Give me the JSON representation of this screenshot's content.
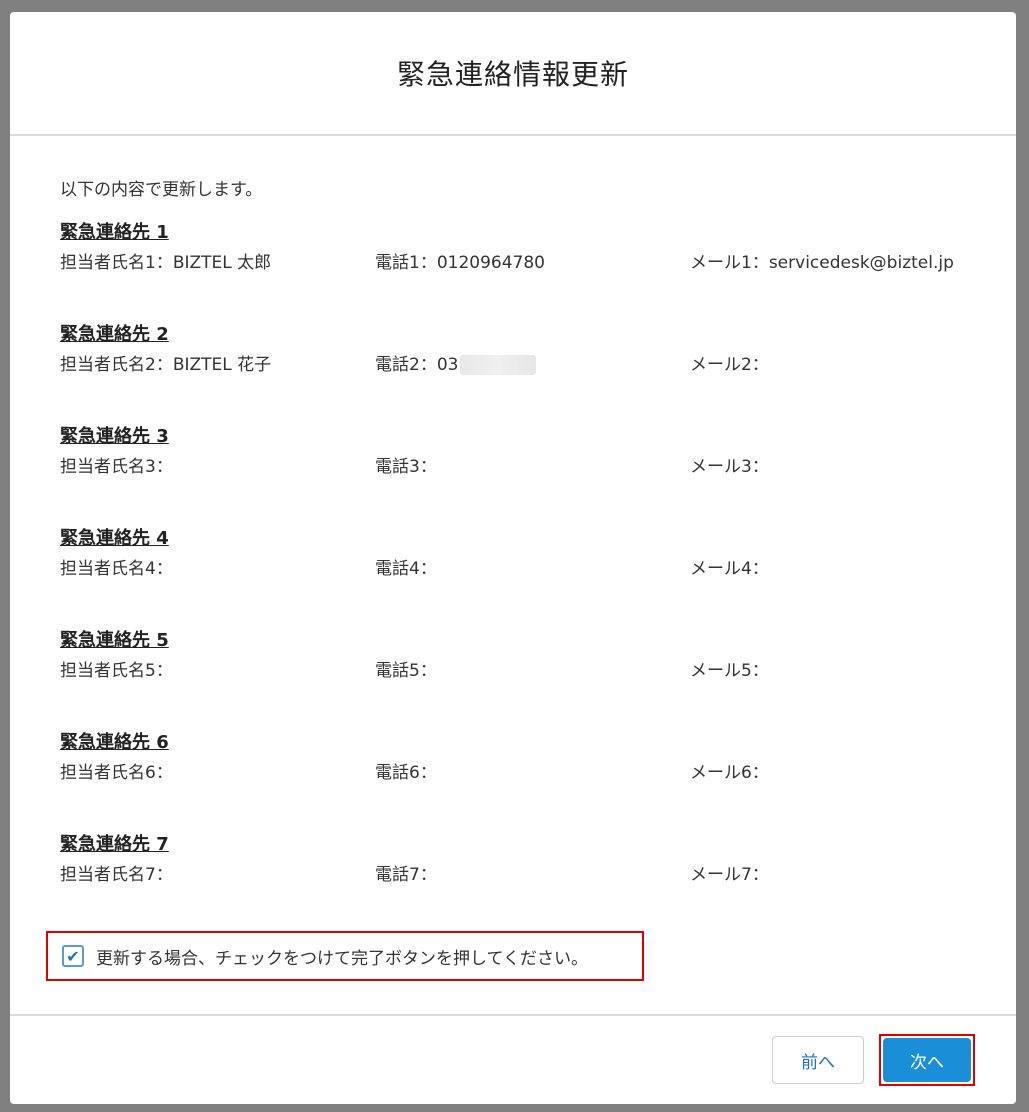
{
  "modal": {
    "title": "緊急連絡情報更新",
    "intro": "以下の内容で更新します。"
  },
  "contacts": [
    {
      "heading": "緊急連絡先 1",
      "name_label": "担当者氏名1：",
      "name_value": "BIZTEL 太郎",
      "phone_label": "電話1：",
      "phone_value": "0120964780",
      "mail_label": "メール1：",
      "mail_value": "servicedesk@biztel.jp"
    },
    {
      "heading": "緊急連絡先 2",
      "name_label": "担当者氏名2：",
      "name_value": "BIZTEL 花子",
      "phone_label": "電話2：",
      "phone_value": "03",
      "mail_label": "メール2：",
      "mail_value": ""
    },
    {
      "heading": "緊急連絡先 3",
      "name_label": "担当者氏名3：",
      "name_value": "",
      "phone_label": "電話3：",
      "phone_value": "",
      "mail_label": "メール3：",
      "mail_value": ""
    },
    {
      "heading": "緊急連絡先 4",
      "name_label": "担当者氏名4：",
      "name_value": "",
      "phone_label": "電話4：",
      "phone_value": "",
      "mail_label": "メール4：",
      "mail_value": ""
    },
    {
      "heading": "緊急連絡先 5",
      "name_label": "担当者氏名5：",
      "name_value": "",
      "phone_label": "電話5：",
      "phone_value": "",
      "mail_label": "メール5：",
      "mail_value": ""
    },
    {
      "heading": "緊急連絡先 6",
      "name_label": "担当者氏名6：",
      "name_value": "",
      "phone_label": "電話6：",
      "phone_value": "",
      "mail_label": "メール6：",
      "mail_value": ""
    },
    {
      "heading": "緊急連絡先 7",
      "name_label": "担当者氏名7：",
      "name_value": "",
      "phone_label": "電話7：",
      "phone_value": "",
      "mail_label": "メール7：",
      "mail_value": ""
    }
  ],
  "confirm": {
    "checked": true,
    "check_glyph": "✔",
    "text": "更新する場合、チェックをつけて完了ボタンを押してください。"
  },
  "footer": {
    "prev_label": "前へ",
    "next_label": "次へ"
  },
  "colors": {
    "primary": "#1a8fd8",
    "highlight": "#e00000"
  }
}
